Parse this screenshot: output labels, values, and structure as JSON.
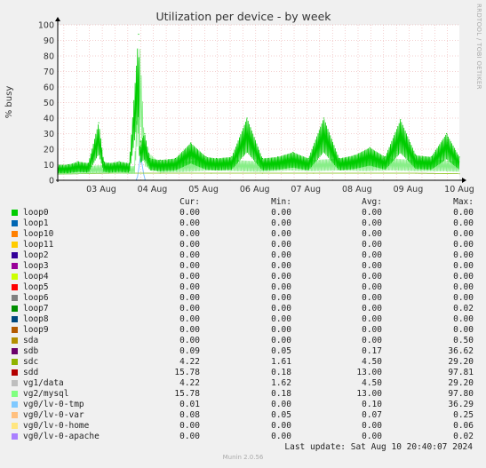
{
  "chart_data": {
    "type": "line",
    "title": "Utilization per device - by week",
    "ylabel": "% busy",
    "xlabel": "",
    "ylim": [
      0,
      100
    ],
    "yticks": [
      0,
      10,
      20,
      30,
      40,
      50,
      60,
      70,
      80,
      90,
      100
    ],
    "xticks": [
      "03 Aug",
      "04 Aug",
      "05 Aug",
      "06 Aug",
      "07 Aug",
      "08 Aug",
      "09 Aug",
      "10 Aug"
    ],
    "grid": true,
    "series": [
      {
        "name": "sdd",
        "color": "#00cc00",
        "x": [
          0,
          0.2,
          0.4,
          0.6,
          0.8,
          0.9,
          1.0,
          1.2,
          1.4,
          1.6,
          1.58,
          1.62,
          1.7,
          1.8,
          2.0,
          2.3,
          2.6,
          2.9,
          3.1,
          3.4,
          3.7,
          4.0,
          4.3,
          4.6,
          4.9,
          5.2,
          5.5,
          5.8,
          6.1,
          6.4,
          6.7,
          7.0,
          7.3,
          7.6,
          7.85
        ],
        "values": [
          10,
          10,
          12,
          11,
          37,
          12,
          11,
          12,
          11,
          20,
          94,
          25,
          30,
          14,
          13,
          14,
          24,
          15,
          14,
          15,
          40,
          14,
          15,
          18,
          14,
          40,
          14,
          16,
          21,
          15,
          39,
          16,
          15,
          30,
          15
        ]
      },
      {
        "name": "vg2/mysql",
        "color": "#88ee88",
        "x": [
          0,
          0.5,
          1.0,
          1.5,
          1.6,
          1.7,
          2.0,
          2.5,
          3.0,
          3.5,
          4.0,
          4.5,
          5.0,
          5.5,
          6.0,
          6.5,
          7.0,
          7.5,
          7.85
        ],
        "values": [
          8,
          9,
          10,
          9,
          90,
          20,
          11,
          12,
          14,
          13,
          12,
          14,
          13,
          14,
          13,
          14,
          13,
          13,
          12
        ]
      },
      {
        "name": "sdc",
        "color": "#99cc33",
        "x": [
          0,
          1,
          2,
          3,
          4,
          5,
          6,
          7,
          7.85
        ],
        "values": [
          4,
          4.5,
          4.5,
          4.5,
          4.5,
          4.5,
          4.5,
          4.5,
          4.2
        ]
      },
      {
        "name": "vg1/data",
        "color": "#aaaaaa",
        "x": [
          0,
          1,
          2,
          3,
          4,
          5,
          6,
          7,
          7.85
        ],
        "values": [
          4,
          4.5,
          4.5,
          4.5,
          4.5,
          4.5,
          4.5,
          4.5,
          4.2
        ]
      },
      {
        "name": "vg0/lv-0-tmp",
        "color": "#77bbff",
        "x": [
          0,
          1.55,
          1.62,
          1.7,
          7.85
        ],
        "values": [
          0,
          0,
          16,
          0,
          0
        ]
      }
    ]
  },
  "legend": {
    "headers": {
      "cur": "Cur:",
      "min": "Min:",
      "avg": "Avg:",
      "max": "Max:"
    },
    "rows": [
      {
        "name": "loop0",
        "color": "#00cc00",
        "cur": "0.00",
        "min": "0.00",
        "avg": "0.00",
        "max": "0.00"
      },
      {
        "name": "loop1",
        "color": "#0066b3",
        "cur": "0.00",
        "min": "0.00",
        "avg": "0.00",
        "max": "0.00"
      },
      {
        "name": "loop10",
        "color": "#ff8000",
        "cur": "0.00",
        "min": "0.00",
        "avg": "0.00",
        "max": "0.00"
      },
      {
        "name": "loop11",
        "color": "#ffcc00",
        "cur": "0.00",
        "min": "0.00",
        "avg": "0.00",
        "max": "0.00"
      },
      {
        "name": "loop2",
        "color": "#330099",
        "cur": "0.00",
        "min": "0.00",
        "avg": "0.00",
        "max": "0.00"
      },
      {
        "name": "loop3",
        "color": "#990099",
        "cur": "0.00",
        "min": "0.00",
        "avg": "0.00",
        "max": "0.00"
      },
      {
        "name": "loop4",
        "color": "#ccff00",
        "cur": "0.00",
        "min": "0.00",
        "avg": "0.00",
        "max": "0.00"
      },
      {
        "name": "loop5",
        "color": "#ff0000",
        "cur": "0.00",
        "min": "0.00",
        "avg": "0.00",
        "max": "0.00"
      },
      {
        "name": "loop6",
        "color": "#808080",
        "cur": "0.00",
        "min": "0.00",
        "avg": "0.00",
        "max": "0.00"
      },
      {
        "name": "loop7",
        "color": "#008f00",
        "cur": "0.00",
        "min": "0.00",
        "avg": "0.00",
        "max": "0.02"
      },
      {
        "name": "loop8",
        "color": "#00487d",
        "cur": "0.00",
        "min": "0.00",
        "avg": "0.00",
        "max": "0.00"
      },
      {
        "name": "loop9",
        "color": "#b35a00",
        "cur": "0.00",
        "min": "0.00",
        "avg": "0.00",
        "max": "0.00"
      },
      {
        "name": "sda",
        "color": "#b38f00",
        "cur": "0.00",
        "min": "0.00",
        "avg": "0.00",
        "max": "0.50"
      },
      {
        "name": "sdb",
        "color": "#6b006b",
        "cur": "0.09",
        "min": "0.05",
        "avg": "0.17",
        "max": "36.62"
      },
      {
        "name": "sdc",
        "color": "#8fb300",
        "cur": "4.22",
        "min": "1.61",
        "avg": "4.50",
        "max": "29.20"
      },
      {
        "name": "sdd",
        "color": "#b30000",
        "cur": "15.78",
        "min": "0.18",
        "avg": "13.00",
        "max": "97.81"
      },
      {
        "name": "vg1/data",
        "color": "#bebebe",
        "cur": "4.22",
        "min": "1.62",
        "avg": "4.50",
        "max": "29.20"
      },
      {
        "name": "vg2/mysql",
        "color": "#80ff80",
        "cur": "15.78",
        "min": "0.18",
        "avg": "13.00",
        "max": "97.80"
      },
      {
        "name": "vg0/lv-0-tmp",
        "color": "#80c9ff",
        "cur": "0.01",
        "min": "0.00",
        "avg": "0.10",
        "max": "36.29"
      },
      {
        "name": "vg0/lv-0-var",
        "color": "#ffc080",
        "cur": "0.08",
        "min": "0.05",
        "avg": "0.07",
        "max": "0.25"
      },
      {
        "name": "vg0/lv-0-home",
        "color": "#ffe680",
        "cur": "0.00",
        "min": "0.00",
        "avg": "0.00",
        "max": "0.06"
      },
      {
        "name": "vg0/lv-0-apache",
        "color": "#aa80ff",
        "cur": "0.00",
        "min": "0.00",
        "avg": "0.00",
        "max": "0.02"
      }
    ]
  },
  "last_update": "Last update: Sat Aug 10 20:40:07 2024",
  "footer": "Munin 2.0.56",
  "side_label": "RRDTOOL / TOBI OETIKER"
}
